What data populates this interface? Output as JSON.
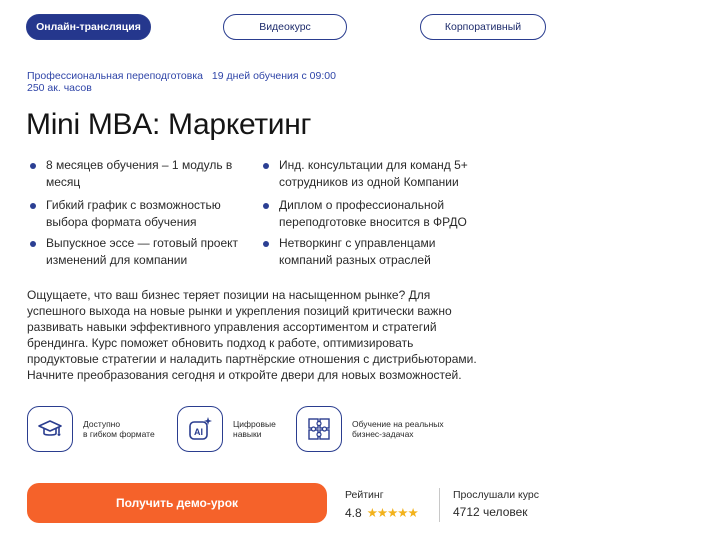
{
  "tabs": [
    {
      "label": "Онлайн-трансляция",
      "active": true
    },
    {
      "label": "Видеокурс",
      "active": false
    },
    {
      "label": "Корпоративный",
      "active": false
    }
  ],
  "meta": {
    "program": "Профессиональная переподготовка",
    "schedule": "19 дней обучения с 09:00",
    "hours": "250 ак. часов"
  },
  "title": "Mini MBA: Маркетинг",
  "features": [
    "8 месяцев обучения – 1 модуль в месяц",
    "Гибкий график с возможностью выбора формата обучения",
    "Выпускное эссе — готовый проект изменений для компании",
    "Инд. консультации для команд 5+ сотрудников из одной Компании",
    "Диплом о профессиональной переподготовке вносится в ФРДО",
    "Нетворкинг с управленцами компаний разных отраслей"
  ],
  "description": "Ощущаете, что ваш бизнес теряет позиции на насыщенном рынке? Для успешного выхода на новые рынки и укрепления позиций критически важно развивать навыки эффективного управления ассортиментом и стратегий брендинга. Курс поможет обновить подход к работе, оптимизировать продуктовые стратегии и наладить партнёрские отношения с дистрибьюторами. Начните преобразования сегодня и откройте двери для новых возможностей.",
  "badges": [
    {
      "line1": "Доступно",
      "line2": "в гибком формате",
      "icon": "graduation-cap-icon"
    },
    {
      "line1": "Цифровые",
      "line2": "навыки",
      "icon": "ai-icon"
    },
    {
      "line1": "Обучение на реальных",
      "line2": "бизнес-задачах",
      "icon": "puzzle-icon"
    }
  ],
  "cta_label": "Получить демо-урок",
  "rating": {
    "label": "Рейтинг",
    "value": "4.8",
    "stars": "★★★★★"
  },
  "listeners": {
    "label": "Прослушали курс",
    "value": "4712 человек"
  },
  "colors": {
    "primary": "#25378d",
    "accent": "#f5622a",
    "star": "#f2b21c"
  }
}
